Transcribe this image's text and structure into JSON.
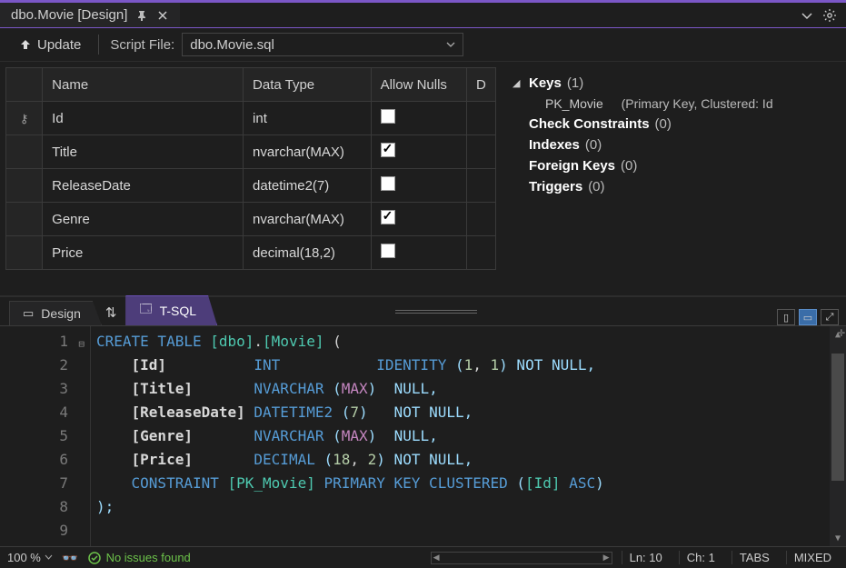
{
  "tab": {
    "title": "dbo.Movie [Design]"
  },
  "toolbar": {
    "update_label": "Update",
    "script_file_label": "Script File:",
    "script_file_value": "dbo.Movie.sql"
  },
  "grid": {
    "headers": {
      "name": "Name",
      "datatype": "Data Type",
      "allownulls": "Allow Nulls",
      "default": "D"
    },
    "rows": [
      {
        "key": true,
        "name": "Id",
        "datatype": "int",
        "allownulls": false
      },
      {
        "key": false,
        "name": "Title",
        "datatype": "nvarchar(MAX)",
        "allownulls": true
      },
      {
        "key": false,
        "name": "ReleaseDate",
        "datatype": "datetime2(7)",
        "allownulls": false
      },
      {
        "key": false,
        "name": "Genre",
        "datatype": "nvarchar(MAX)",
        "allownulls": true
      },
      {
        "key": false,
        "name": "Price",
        "datatype": "decimal(18,2)",
        "allownulls": false
      }
    ]
  },
  "tree": {
    "keys_label": "Keys",
    "keys_count": "(1)",
    "pk_name": "PK_Movie",
    "pk_detail": "(Primary Key, Clustered: Id",
    "check_label": "Check Constraints",
    "check_count": "(0)",
    "indexes_label": "Indexes",
    "indexes_count": "(0)",
    "fk_label": "Foreign Keys",
    "fk_count": "(0)",
    "triggers_label": "Triggers",
    "triggers_count": "(0)"
  },
  "pane_tabs": {
    "design": "Design",
    "tsql": "T-SQL"
  },
  "sql": {
    "l1_a": "CREATE TABLE ",
    "l1_b": "[dbo]",
    "l1_c": ".",
    "l1_d": "[Movie]",
    "l1_e": " (",
    "l2_a": "    ",
    "l2_b": "[Id]",
    "l2_c": "          ",
    "l2_d": "INT",
    "l2_e": "           ",
    "l2_f": "IDENTITY ",
    "l2_g": "(",
    "l2_h": "1",
    "l2_i": ", ",
    "l2_j": "1",
    "l2_k": ")",
    "l2_l": " NOT NULL,",
    "l3_a": "    ",
    "l3_b": "[Title]",
    "l3_c": "       ",
    "l3_d": "NVARCHAR ",
    "l3_e": "(",
    "l3_f": "MAX",
    "l3_g": ")",
    "l3_h": "  NULL,",
    "l4_a": "    ",
    "l4_b": "[ReleaseDate]",
    "l4_c": " ",
    "l4_d": "DATETIME2 ",
    "l4_e": "(",
    "l4_f": "7",
    "l4_g": ")",
    "l4_h": "   NOT NULL,",
    "l5_a": "    ",
    "l5_b": "[Genre]",
    "l5_c": "       ",
    "l5_d": "NVARCHAR ",
    "l5_e": "(",
    "l5_f": "MAX",
    "l5_g": ")",
    "l5_h": "  NULL,",
    "l6_a": "    ",
    "l6_b": "[Price]",
    "l6_c": "       ",
    "l6_d": "DECIMAL ",
    "l6_e": "(",
    "l6_f": "18",
    "l6_g": ", ",
    "l6_h": "2",
    "l6_i": ")",
    "l6_j": " NOT NULL,",
    "l7_a": "    ",
    "l7_b": "CONSTRAINT ",
    "l7_c": "[PK_Movie]",
    "l7_d": " PRIMARY KEY CLUSTERED ",
    "l7_e": "(",
    "l7_f": "[Id]",
    "l7_g": " ASC",
    "l7_h": ")",
    "l8": ");"
  },
  "line_numbers": [
    "1",
    "2",
    "3",
    "4",
    "5",
    "6",
    "7",
    "8",
    "9"
  ],
  "status": {
    "zoom": "100 %",
    "issues": "No issues found",
    "ln": "Ln: 10",
    "ch": "Ch: 1",
    "tabs": "TABS",
    "mixed": "MIXED"
  }
}
